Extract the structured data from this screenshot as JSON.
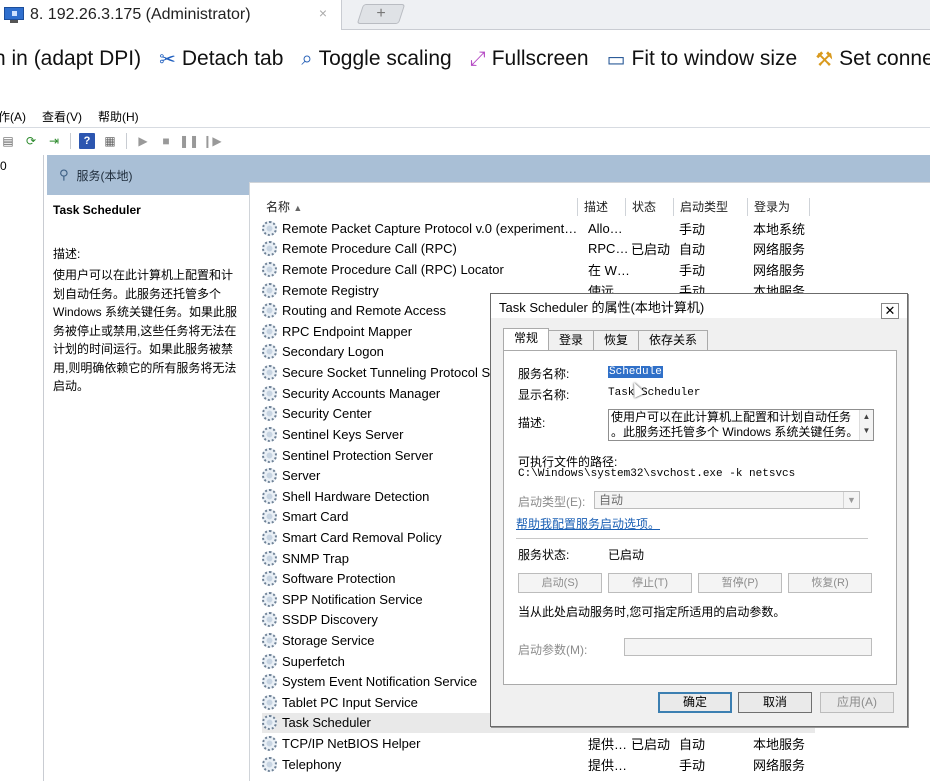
{
  "rdp": {
    "tab_title": "8. 192.26.3.175 (Administrator)",
    "tab_close": "×",
    "new_tab": "+",
    "toolbar": [
      {
        "label": "n in (adapt DPI)",
        "icon": "none"
      },
      {
        "label": "Detach tab",
        "icon": "scissors-icon",
        "glyph": "✂",
        "color": "#1f5fbf"
      },
      {
        "label": "Toggle scaling",
        "icon": "magnifier-icon",
        "glyph": "🔍",
        "color": "#2a63b8"
      },
      {
        "label": "Fullscreen",
        "icon": "fullscreen-icon",
        "glyph": "⤢",
        "color": "#b54bc4"
      },
      {
        "label": "Fit to window size",
        "icon": "monitor-icon",
        "glyph": "🖥",
        "color": "#2d5c99"
      },
      {
        "label": "Set connec",
        "icon": "wrench-icon",
        "glyph": "🔧",
        "color": "#d99a1e"
      }
    ]
  },
  "mmc": {
    "menu": [
      "作(A)",
      "查看(V)",
      "帮助(H)"
    ],
    "tree_stub": "0",
    "header": "服务(本地)",
    "detail": {
      "title": "Task Scheduler",
      "desc_label": "描述:",
      "desc_text": "使用户可以在此计算机上配置和计划自动任务。此服务还托管多个 Windows 系统关键任务。如果此服务被停止或禁用,这些任务将无法在计划的时间运行。如果此服务被禁用,则明确依赖它的所有服务将无法启动。"
    },
    "columns": [
      "名称",
      "描述",
      "状态",
      "启动类型",
      "登录为"
    ],
    "sort_indicator": "▲",
    "rows": [
      {
        "name": "Remote Packet Capture Protocol v.0 (experiment…",
        "desc": "Allo…",
        "status": "",
        "start": "手动",
        "logon": "本地系统"
      },
      {
        "name": "Remote Procedure Call (RPC)",
        "desc": "RPC…",
        "status": "已启动",
        "start": "自动",
        "logon": "网络服务"
      },
      {
        "name": "Remote Procedure Call (RPC) Locator",
        "desc": "在 W…",
        "status": "",
        "start": "手动",
        "logon": "网络服务"
      },
      {
        "name": "Remote Registry",
        "desc": "使远…",
        "status": "",
        "start": "手动",
        "logon": "本地服务"
      },
      {
        "name": "Routing and Remote Access",
        "desc": "",
        "status": "",
        "start": "",
        "logon": ""
      },
      {
        "name": "RPC Endpoint Mapper",
        "desc": "",
        "status": "",
        "start": "",
        "logon": ""
      },
      {
        "name": "Secondary Logon",
        "desc": "",
        "status": "",
        "start": "",
        "logon": ""
      },
      {
        "name": "Secure Socket Tunneling Protocol S",
        "desc": "",
        "status": "",
        "start": "",
        "logon": ""
      },
      {
        "name": "Security Accounts Manager",
        "desc": "",
        "status": "",
        "start": "",
        "logon": ""
      },
      {
        "name": "Security Center",
        "desc": "",
        "status": "",
        "start": "",
        "logon": ""
      },
      {
        "name": "Sentinel Keys Server",
        "desc": "",
        "status": "",
        "start": "",
        "logon": ""
      },
      {
        "name": "Sentinel Protection Server",
        "desc": "",
        "status": "",
        "start": "",
        "logon": ""
      },
      {
        "name": "Server",
        "desc": "",
        "status": "",
        "start": "",
        "logon": ""
      },
      {
        "name": "Shell Hardware Detection",
        "desc": "",
        "status": "",
        "start": "",
        "logon": ""
      },
      {
        "name": "Smart Card",
        "desc": "",
        "status": "",
        "start": "",
        "logon": ""
      },
      {
        "name": "Smart Card Removal Policy",
        "desc": "",
        "status": "",
        "start": "",
        "logon": ""
      },
      {
        "name": "SNMP Trap",
        "desc": "",
        "status": "",
        "start": "",
        "logon": ""
      },
      {
        "name": "Software Protection",
        "desc": "",
        "status": "",
        "start": "",
        "logon": ""
      },
      {
        "name": "SPP Notification Service",
        "desc": "",
        "status": "",
        "start": "",
        "logon": ""
      },
      {
        "name": "SSDP Discovery",
        "desc": "",
        "status": "",
        "start": "",
        "logon": ""
      },
      {
        "name": "Storage Service",
        "desc": "",
        "status": "",
        "start": "",
        "logon": ""
      },
      {
        "name": "Superfetch",
        "desc": "",
        "status": "",
        "start": "",
        "logon": ""
      },
      {
        "name": "System Event Notification Service",
        "desc": "",
        "status": "",
        "start": "",
        "logon": ""
      },
      {
        "name": "Tablet PC Input Service",
        "desc": "",
        "status": "",
        "start": "",
        "logon": ""
      },
      {
        "name": "Task Scheduler",
        "desc": "",
        "status": "",
        "start": "",
        "logon": "",
        "selected": true
      },
      {
        "name": "TCP/IP NetBIOS Helper",
        "desc": "提供…",
        "status": "已启动",
        "start": "自动",
        "logon": "本地服务"
      },
      {
        "name": "Telephony",
        "desc": "提供…",
        "status": "",
        "start": "手动",
        "logon": "网络服务"
      }
    ]
  },
  "dialog": {
    "title": "Task Scheduler 的属性(本地计算机)",
    "close": "✕",
    "tabs": [
      "常规",
      "登录",
      "恢复",
      "依存关系"
    ],
    "service_name_label": "服务名称:",
    "service_name": "Schedule",
    "display_name_label": "显示名称:",
    "display_name": "Task Scheduler",
    "desc_label": "描述:",
    "desc_line1": "使用户可以在此计算机上配置和计划自动任务",
    "desc_line2": "。此服务还托管多个 Windows 系统关键任务。",
    "path_label": "可执行文件的路径:",
    "path": "C:\\Windows\\system32\\svchost.exe -k netsvcs",
    "startup_type_label": "启动类型(E):",
    "startup_type": "自动",
    "help_link": "帮助我配置服务启动选项。",
    "status_label": "服务状态:",
    "status": "已启动",
    "start_btn": "启动(S)",
    "stop_btn": "停止(T)",
    "pause_btn": "暂停(P)",
    "resume_btn": "恢复(R)",
    "hint": "当从此处启动服务时,您可指定所适用的启动参数。",
    "params_label": "启动参数(M):",
    "ok": "确定",
    "cancel": "取消",
    "apply": "应用(A)"
  }
}
